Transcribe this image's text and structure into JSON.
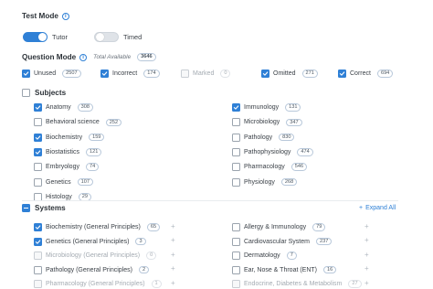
{
  "test_mode": {
    "title": "Test Mode",
    "tutor_label": "Tutor",
    "timed_label": "Timed",
    "tutor_on": true,
    "timed_on": false
  },
  "question_mode": {
    "title": "Question Mode",
    "total_label": "Total Available",
    "total_value": "3646",
    "options": [
      {
        "label": "Unused",
        "count": "2507",
        "checked": true,
        "disabled": false
      },
      {
        "label": "Incorrect",
        "count": "174",
        "checked": true,
        "disabled": false
      },
      {
        "label": "Marked",
        "count": "0",
        "checked": false,
        "disabled": true
      },
      {
        "label": "Omitted",
        "count": "271",
        "checked": true,
        "disabled": false
      },
      {
        "label": "Correct",
        "count": "694",
        "checked": true,
        "disabled": false
      }
    ]
  },
  "subjects": {
    "title": "Subjects",
    "left": [
      {
        "label": "Anatomy",
        "count": "308",
        "checked": true
      },
      {
        "label": "Behavioral science",
        "count": "252",
        "checked": false
      },
      {
        "label": "Biochemistry",
        "count": "159",
        "checked": true
      },
      {
        "label": "Biostatistics",
        "count": "121",
        "checked": true
      },
      {
        "label": "Embryology",
        "count": "74",
        "checked": false
      },
      {
        "label": "Genetics",
        "count": "107",
        "checked": false
      },
      {
        "label": "Histology",
        "count": "29",
        "checked": false
      }
    ],
    "right": [
      {
        "label": "Immunology",
        "count": "131",
        "checked": true
      },
      {
        "label": "Microbiology",
        "count": "347",
        "checked": false
      },
      {
        "label": "Pathology",
        "count": "830",
        "checked": false
      },
      {
        "label": "Pathophysiology",
        "count": "474",
        "checked": false
      },
      {
        "label": "Pharmacology",
        "count": "546",
        "checked": false
      },
      {
        "label": "Physiology",
        "count": "268",
        "checked": false
      }
    ]
  },
  "systems": {
    "title": "Systems",
    "expand_all_label": "Expand All",
    "left": [
      {
        "label": "Biochemistry (General Principles)",
        "count": "65",
        "checked": true,
        "disabled": false
      },
      {
        "label": "Genetics (General Principles)",
        "count": "3",
        "checked": true,
        "disabled": false
      },
      {
        "label": "Microbiology (General Principles)",
        "count": "0",
        "checked": false,
        "disabled": true
      },
      {
        "label": "Pathology (General Principles)",
        "count": "2",
        "checked": false,
        "disabled": false
      },
      {
        "label": "Pharmacology (General Principles)",
        "count": "1",
        "checked": false,
        "disabled": true
      }
    ],
    "right": [
      {
        "label": "Allergy & Immunology",
        "count": "79",
        "checked": false,
        "disabled": false
      },
      {
        "label": "Cardiovascular System",
        "count": "237",
        "checked": false,
        "disabled": false
      },
      {
        "label": "Dermatology",
        "count": "7",
        "checked": false,
        "disabled": false
      },
      {
        "label": "Ear, Nose & Throat (ENT)",
        "count": "16",
        "checked": false,
        "disabled": false
      },
      {
        "label": "Endocrine, Diabetes & Metabolism",
        "count": "27",
        "checked": false,
        "disabled": true
      }
    ]
  },
  "colors": {
    "accent": "#2f80d6",
    "text": "#333a42",
    "disabled": "#a4abb2"
  }
}
